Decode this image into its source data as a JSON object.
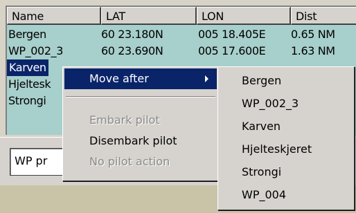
{
  "columns": [
    "Name",
    "LAT",
    "LON",
    "Dist"
  ],
  "rows": [
    {
      "name": "Bergen",
      "lat": "60 23.180N",
      "lon": "005 18.405E",
      "dist": "0.65 NM"
    },
    {
      "name": "WP_002_3",
      "lat": "60 23.690N",
      "lon": "005 17.600E",
      "dist": "1.63 NM"
    },
    {
      "name": "Karven",
      "lat": "",
      "lon": "",
      "dist": ""
    },
    {
      "name": "Hjeltesk",
      "lat": "",
      "lon": "",
      "dist": ""
    },
    {
      "name": "Strongi",
      "lat": "",
      "lon": "",
      "dist": ""
    }
  ],
  "selected_row": "Karven",
  "wp_button_label": "WP pr",
  "context_menu": {
    "move_after": "Move after",
    "embark_pilot": "Embark pilot",
    "disembark_pilot": "Disembark pilot",
    "no_pilot_action": "No pilot action"
  },
  "submenu": [
    "Bergen",
    "WP_002_3",
    "Karven",
    "Hjelteskjeret",
    "Strongi",
    "WP_004"
  ],
  "colors": {
    "list_bg": "#a7cfcb",
    "highlight": "#0a246a",
    "menu_bg": "#d6d3ce"
  }
}
